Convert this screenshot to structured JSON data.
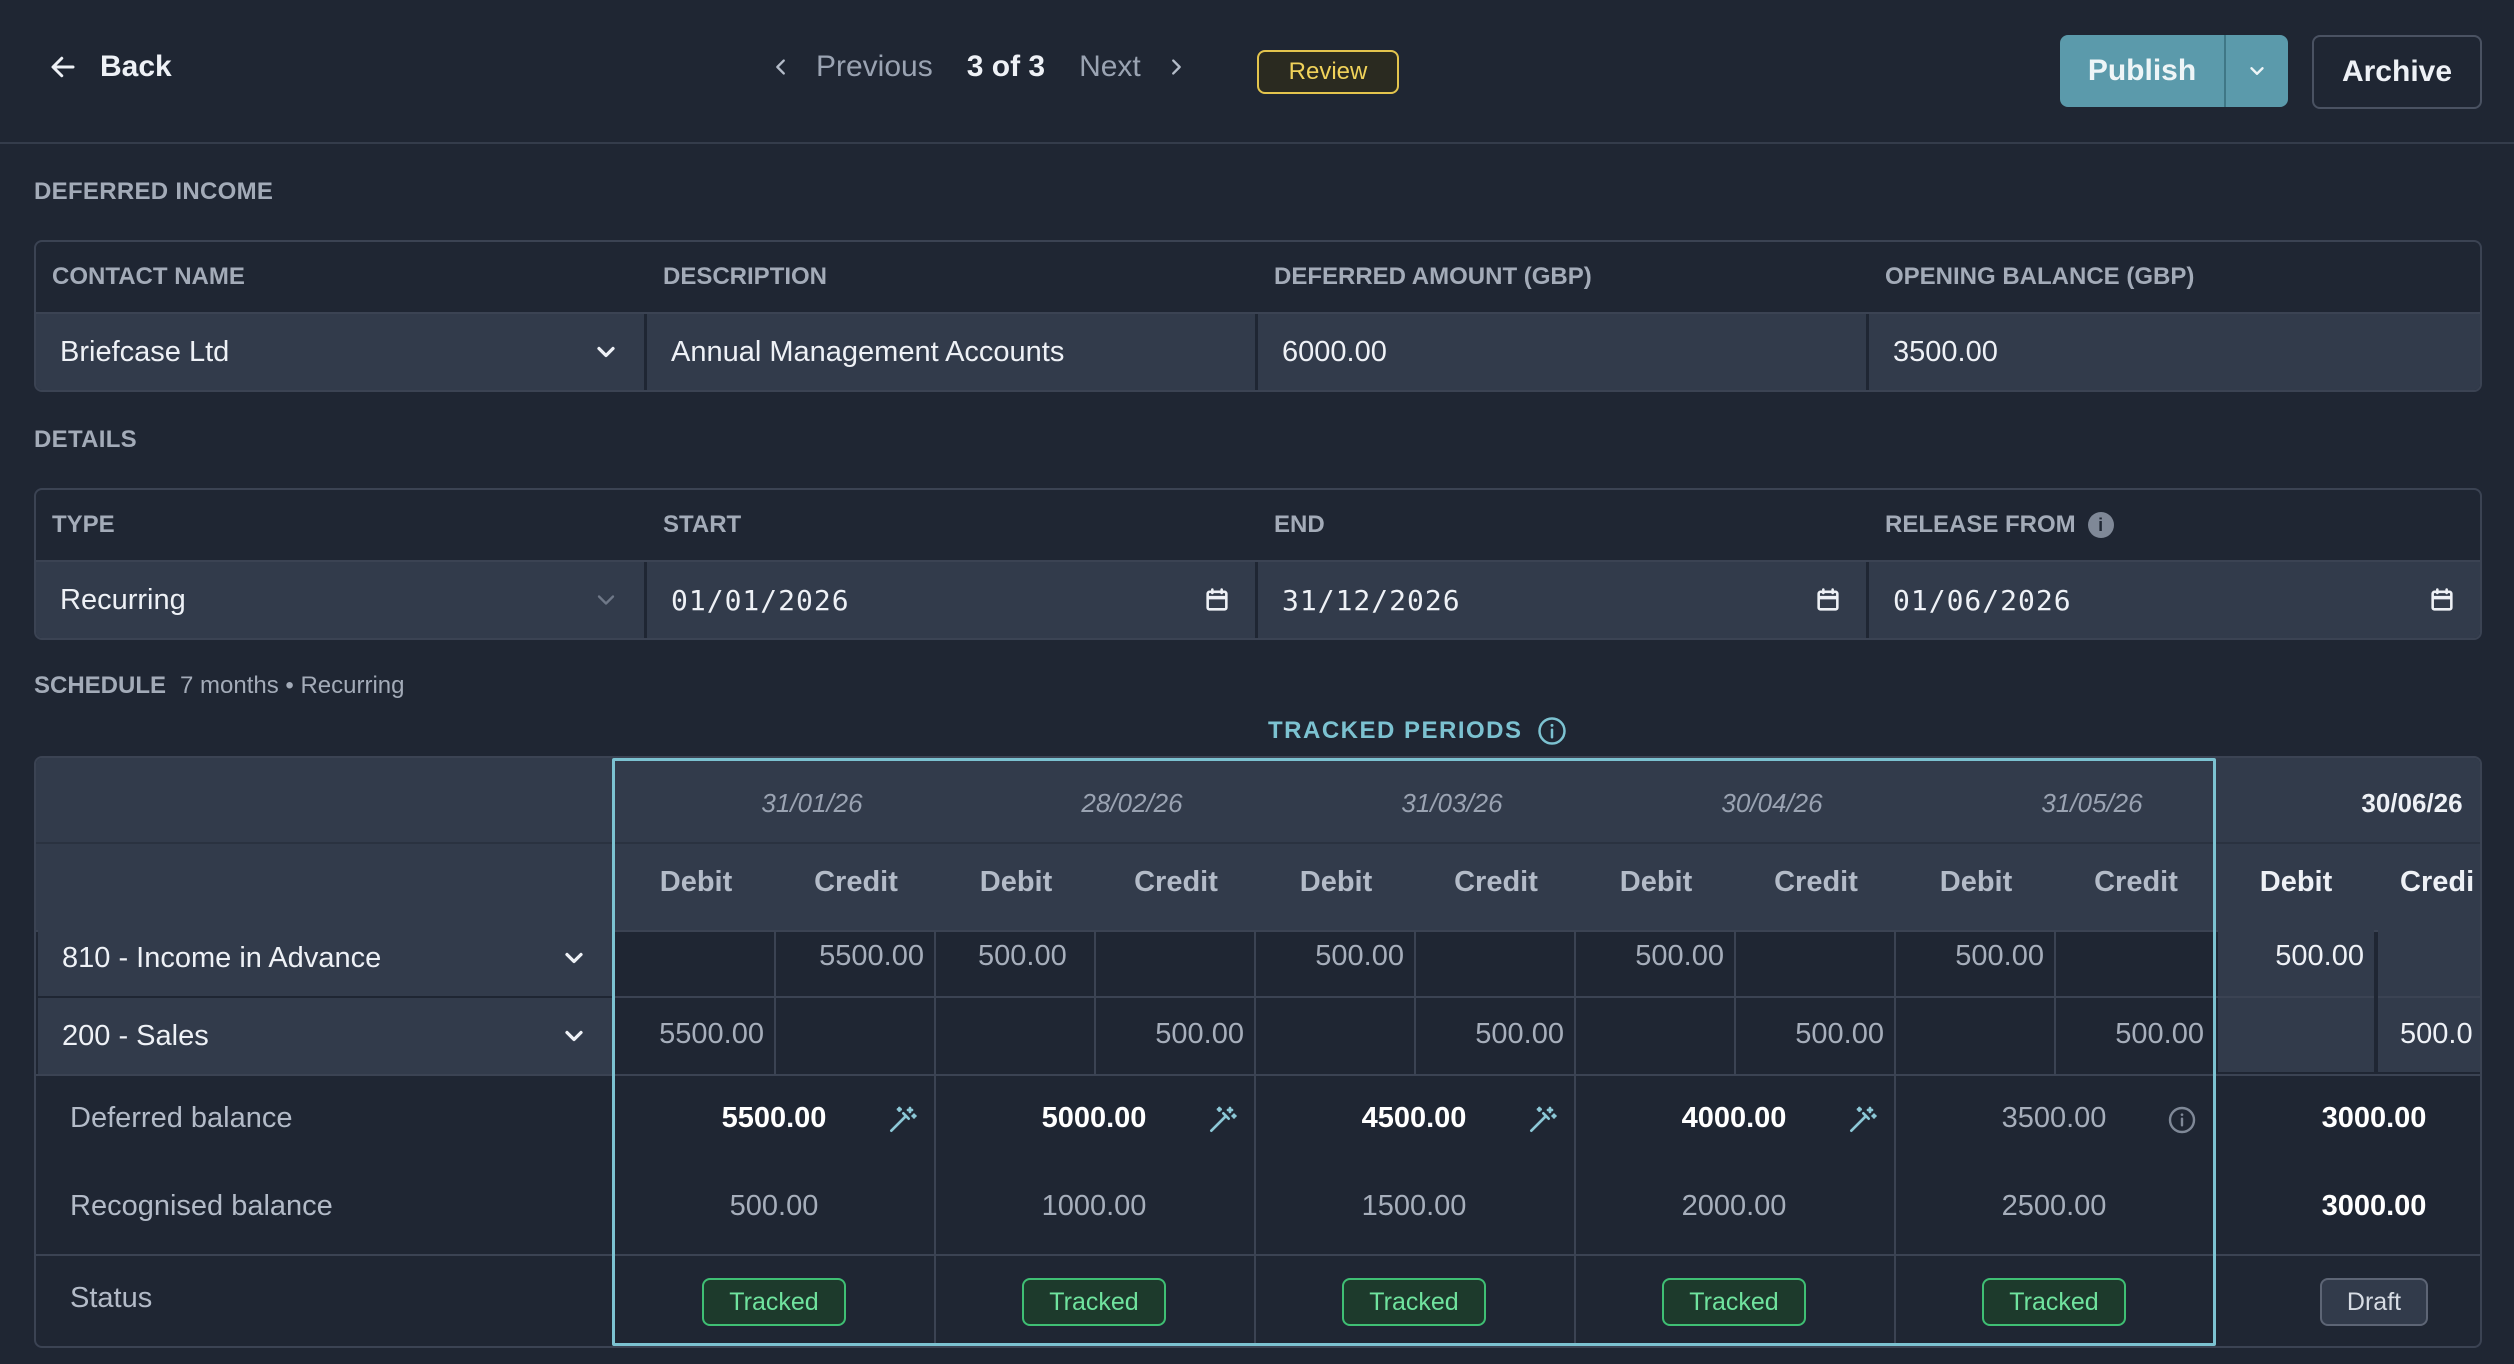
{
  "toolbar": {
    "back_label": "Back",
    "previous_label": "Previous",
    "page_indicator": "3 of 3",
    "next_label": "Next",
    "status_badge": "Review",
    "publish_label": "Publish",
    "archive_label": "Archive"
  },
  "deferred_income": {
    "section_title": "DEFERRED INCOME",
    "headers": [
      "CONTACT NAME",
      "DESCRIPTION",
      "DEFERRED AMOUNT (GBP)",
      "OPENING BALANCE (GBP)"
    ],
    "contact_name": "Briefcase Ltd",
    "description": "Annual Management Accounts",
    "deferred_amount": "6000.00",
    "opening_balance": "3500.00"
  },
  "details": {
    "section_title": "DETAILS",
    "headers": [
      "TYPE",
      "START",
      "END",
      "RELEASE FROM"
    ],
    "type": "Recurring",
    "start": "01/01/2026",
    "end": "31/12/2026",
    "release_from": "01/06/2026"
  },
  "schedule": {
    "section_title": "SCHEDULE",
    "subtitle": "7 months • Recurring",
    "tracked_label": "TRACKED PERIODS",
    "debit_label": "Debit",
    "credit_label": "Credit",
    "last_credit_label": "Credi",
    "periods": [
      "31/01/26",
      "28/02/26",
      "31/03/26",
      "30/04/26",
      "31/05/26",
      "30/06/26"
    ],
    "accounts": [
      {
        "name": "810 - Income in Advance",
        "entries": [
          [
            "",
            "5500.00"
          ],
          [
            "500.00",
            ""
          ],
          [
            "500.00",
            ""
          ],
          [
            "500.00",
            ""
          ],
          [
            "500.00",
            ""
          ],
          [
            "500.00",
            ""
          ]
        ]
      },
      {
        "name": "200 - Sales",
        "entries": [
          [
            "5500.00",
            ""
          ],
          [
            "",
            "500.00"
          ],
          [
            "",
            "500.00"
          ],
          [
            "",
            "500.00"
          ],
          [
            "",
            "500.00"
          ],
          [
            "",
            "500.0"
          ]
        ]
      }
    ],
    "deferred_label": "Deferred balance",
    "deferred": [
      "5500.00",
      "5000.00",
      "4500.00",
      "4000.00",
      "3500.00",
      "3000.00"
    ],
    "recognised_label": "Recognised balance",
    "recognised": [
      "500.00",
      "1000.00",
      "1500.00",
      "2000.00",
      "2500.00",
      "3000.00"
    ],
    "status_label": "Status",
    "statuses": [
      "Tracked",
      "Tracked",
      "Tracked",
      "Tracked",
      "Tracked",
      "Draft"
    ]
  },
  "colors": {
    "background": "#1f2633",
    "accent": "#7cc2d1",
    "publish": "#5b9aab",
    "review": "#e3c44d",
    "tracked": "#3fbf74"
  },
  "icons": {
    "back": "arrow-left-icon",
    "previous": "chevron-left-icon",
    "next": "chevron-right-icon",
    "dropdown": "chevron-down-icon",
    "date": "calendar-icon",
    "info": "info-icon",
    "magic": "magic-wand-icon"
  }
}
